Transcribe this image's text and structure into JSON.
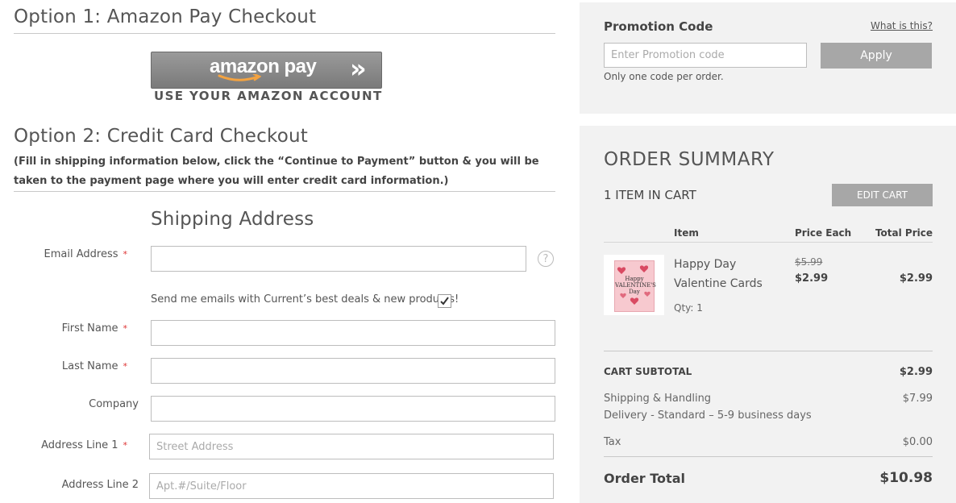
{
  "option1": {
    "title": "Option 1: Amazon Pay Checkout"
  },
  "amazon": {
    "brand": "amazon pay",
    "chevrons": "»",
    "subtitle": "USE YOUR AMAZON ACCOUNT"
  },
  "option2": {
    "title": "Option 2: Credit Card Checkout",
    "note": "(Fill in shipping information below, click the “Continue to Payment” button & you will be taken to the payment page where you will enter credit card information.)"
  },
  "shipping": {
    "title": "Shipping Address",
    "required_mark": "*",
    "help_symbol": "?",
    "email": {
      "label": "Email Address",
      "value": ""
    },
    "newsletter": {
      "label": "Send me emails with Current’s best deals & new products!",
      "checked": true
    },
    "first_name": {
      "label": "First Name",
      "value": ""
    },
    "last_name": {
      "label": "Last Name",
      "value": ""
    },
    "company": {
      "label": "Company",
      "value": ""
    },
    "address1": {
      "label": "Address Line 1",
      "placeholder": "Street Address",
      "value": ""
    },
    "address2": {
      "label": "Address Line 2",
      "placeholder": "Apt.#/Suite/Floor",
      "value": ""
    }
  },
  "promo": {
    "title": "Promotion Code",
    "help_link": "What is this?",
    "placeholder": "Enter Promotion code",
    "apply_label": "Apply",
    "note": "Only one code per order."
  },
  "summary": {
    "title": "ORDER SUMMARY",
    "items_count": "1 ITEM IN CART",
    "edit_label": "EDIT CART",
    "columns": {
      "item": "Item",
      "price_each": "Price Each",
      "total_price": "Total Price"
    },
    "item": {
      "name": "Happy Day Valentine Cards",
      "original_price": "$5.99",
      "price": "$2.99",
      "total": "$2.99",
      "qty": "Qty: 1",
      "thumb_text": "Happy VALENTINE'S Day"
    },
    "subtotal": {
      "label": "CART SUBTOTAL",
      "value": "$2.99"
    },
    "shipping": {
      "label": "Shipping & Handling",
      "detail": "Delivery - Standard – 5-9 business days",
      "value": "$7.99"
    },
    "tax": {
      "label": "Tax",
      "value": "$0.00"
    },
    "total": {
      "label": "Order Total",
      "value": "$10.98"
    }
  },
  "colors": {
    "panel_bg": "#f2f2f2",
    "button_grey": "#a7a7a7",
    "required": "#d33",
    "amazon_orange": "#f4a340"
  }
}
